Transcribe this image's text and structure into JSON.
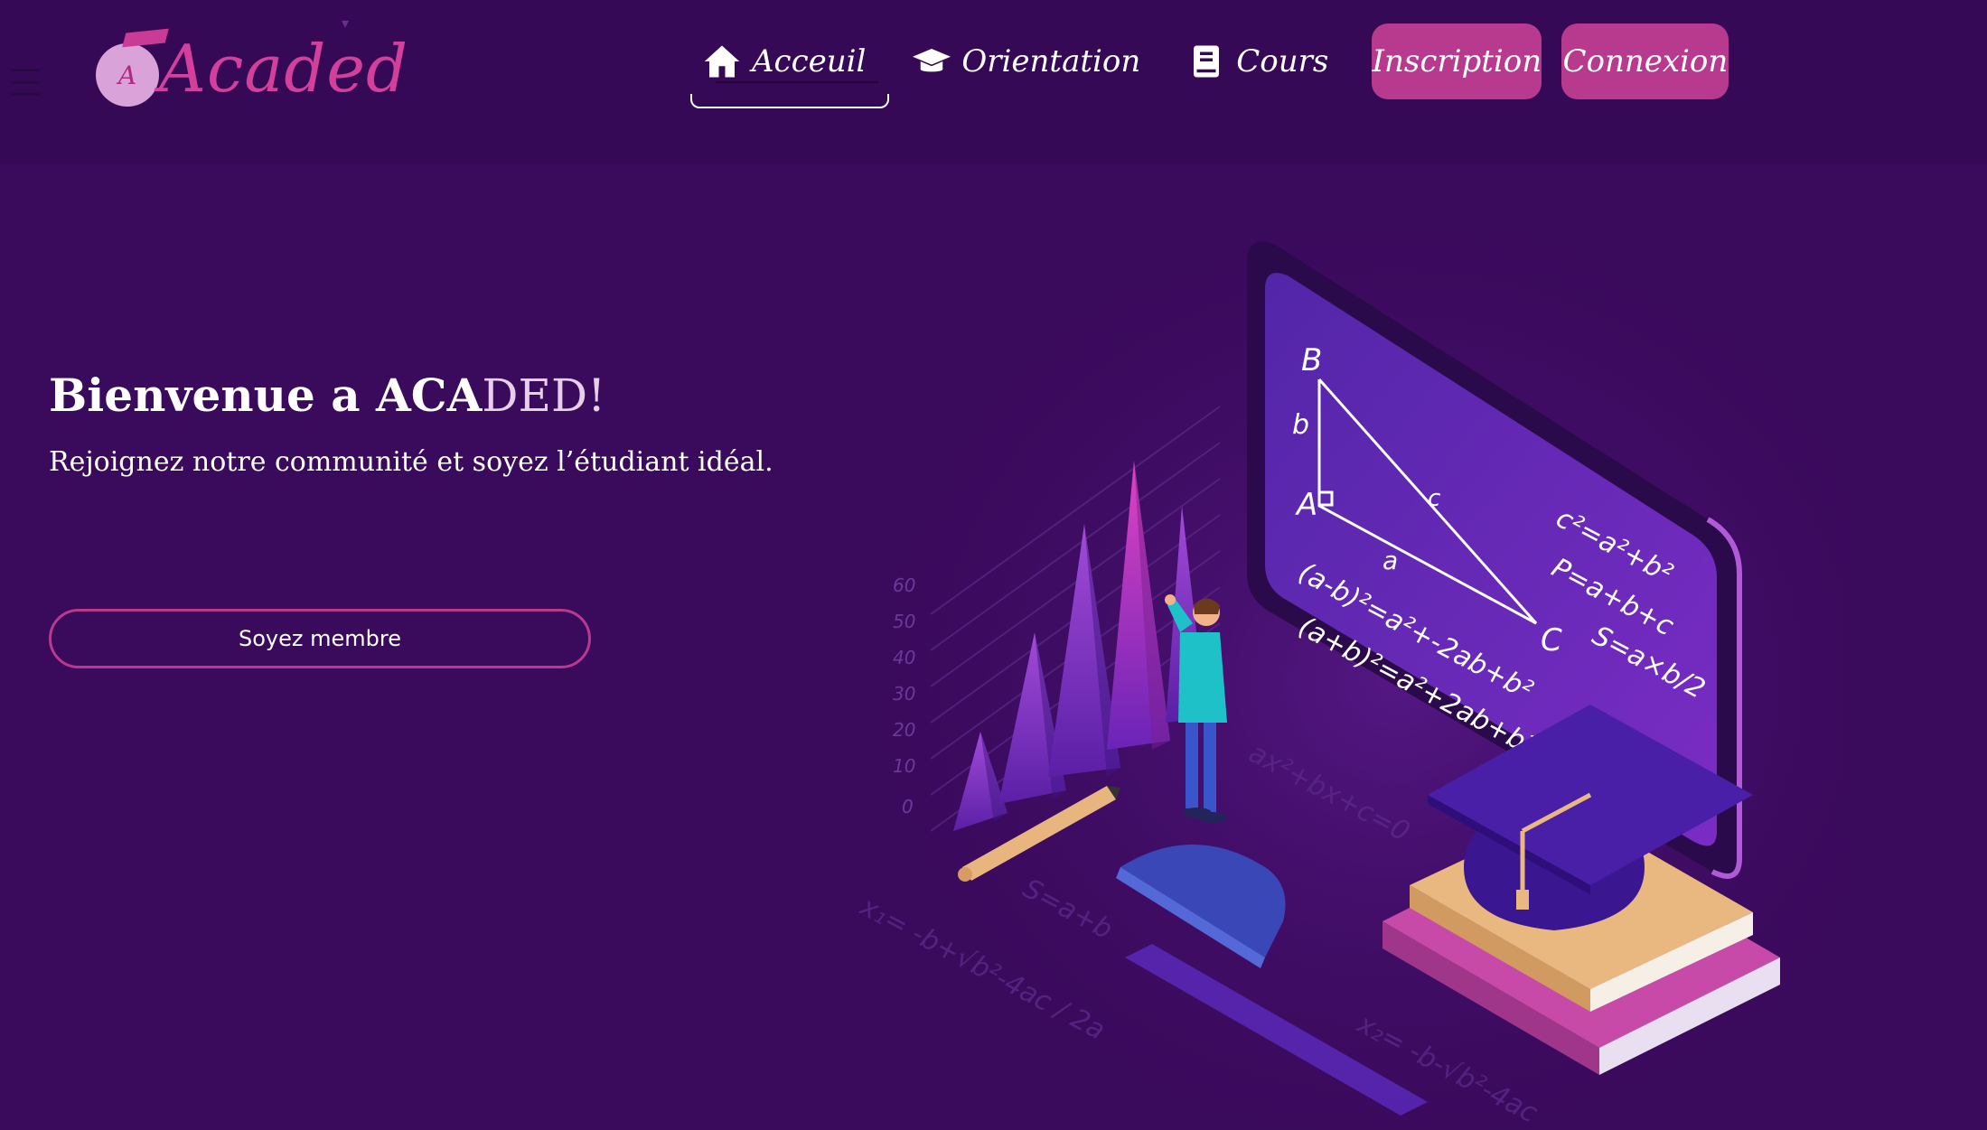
{
  "header": {
    "logo_text": "Acaded",
    "logo_letter": "A",
    "nav": [
      {
        "label": "Acceuil",
        "icon": "home-icon",
        "active": true
      },
      {
        "label": "Orientation",
        "icon": "graduation-cap-icon",
        "active": false
      },
      {
        "label": "Cours",
        "icon": "book-icon",
        "active": false
      }
    ],
    "signup_label": "Inscription",
    "login_label": "Connexion"
  },
  "hero": {
    "title_prefix": "Bienvenue a ACA",
    "title_suffix": "DED!",
    "subtitle": "Rejoignez notre communité et soyez l’étudiant idéal.",
    "cta_label": "Soyez membre"
  },
  "illustration": {
    "board": {
      "vertices": [
        "B",
        "A",
        "C"
      ],
      "sides": [
        "b",
        "c",
        "a"
      ],
      "formulas": [
        "c²=a²+b²",
        "P=a+b+c",
        "S=a×b/2",
        "(a-b)²=a²+-2ab+b²",
        "(a+b)²=a²+2ab+b²"
      ]
    },
    "axis_ticks": [
      "60",
      "50",
      "40",
      "30",
      "20",
      "10",
      "0"
    ],
    "floor_formulas": [
      "S=a+b",
      "x₁= -b+√b²-4ac / 2a",
      "x₂= -b-√b²-4ac",
      "ax²+bx+c=0"
    ]
  },
  "colors": {
    "background": "#3a0a5c",
    "header": "#360957",
    "accent": "#b73a8e",
    "logo": "#d3409b"
  }
}
